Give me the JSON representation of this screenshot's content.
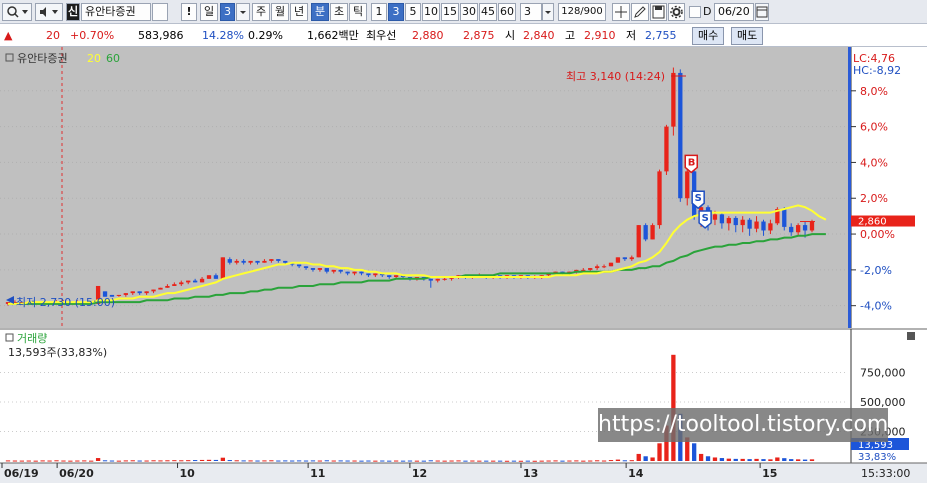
{
  "toolbar": {
    "stock_name": "유안타증권",
    "period_day": "일",
    "period_num": "3",
    "week": "주",
    "month": "월",
    "year": "년",
    "minute": "분",
    "second": "초",
    "tick": "틱",
    "intervals": [
      "1",
      "3",
      "5",
      "10",
      "15",
      "30",
      "45",
      "60"
    ],
    "interval_selected": "3",
    "interval_dropdown": "3",
    "count": "128/900",
    "d_label": "D",
    "date": "06/20",
    "exclaim": "!"
  },
  "quote": {
    "change": "20",
    "change_pct": "+0.70%",
    "volume": "583,986",
    "vol_pct": "14.28%",
    "turnover": "0.29%",
    "amount": "1,662백만",
    "best_bid_label": "최우선",
    "ask": "2,880",
    "bid": "2,875",
    "open_label": "시",
    "open": "2,840",
    "high_label": "고",
    "high": "2,910",
    "low_label": "저",
    "low": "2,755",
    "buy_label": "매수",
    "sell_label": "매도"
  },
  "colors": {
    "up": "#e8231a",
    "down": "#1c55d9",
    "ma20": "#ffff33",
    "ma60": "#2aa33a",
    "bg": "#c0c0c0"
  },
  "chart_data": {
    "type": "candlestick",
    "legend": {
      "name": "유안타증권",
      "ma_short": "20",
      "ma_long": "60"
    },
    "y_ticks": [
      "8,0%",
      "6,0%",
      "4,0%",
      "2,0%",
      "0,00%",
      "-2,0%",
      "-4,0%"
    ],
    "y_values": [
      8,
      6,
      4,
      2,
      0,
      -2,
      -4
    ],
    "ylim": [
      -4.8,
      10.0
    ],
    "lc_label": "LC:4,76",
    "hc_label": "HC:-8,92",
    "current_price": "2,860",
    "current_pct": 0.7,
    "high_annotation": "최고 3,140 (14:24)",
    "low_annotation": "최저 2,730 (15:00)",
    "signals": [
      "B",
      "S",
      "S"
    ],
    "x_labels": [
      "06/19",
      "06/20",
      "10",
      "11",
      "12",
      "13",
      "14",
      "15"
    ],
    "x_label_fracs": [
      0.0,
      0.065,
      0.207,
      0.361,
      0.481,
      0.612,
      0.736,
      0.894
    ],
    "candles": [
      [
        -3.9,
        -3.8,
        -4.0,
        -3.8,
        5000
      ],
      [
        -3.8,
        -3.8,
        -3.9,
        -3.7,
        4000
      ],
      [
        -3.8,
        -3.8,
        -3.9,
        -3.8,
        3500
      ],
      [
        -3.8,
        -3.8,
        -3.9,
        -3.8,
        4000
      ],
      [
        -3.8,
        -3.8,
        -3.9,
        -3.8,
        3000
      ],
      [
        -3.8,
        -3.8,
        -3.9,
        -3.8,
        5000
      ],
      [
        -3.8,
        -3.8,
        -3.8,
        -3.8,
        4000
      ],
      [
        -3.8,
        -3.8,
        -3.9,
        -3.7,
        6000
      ],
      [
        -3.8,
        -3.8,
        -3.8,
        -3.7,
        4000
      ],
      [
        -3.8,
        -3.8,
        -3.9,
        -3.8,
        3000
      ],
      [
        -3.8,
        -3.8,
        -3.8,
        -3.7,
        4000
      ],
      [
        -3.8,
        -3.8,
        -3.9,
        -3.8,
        5000
      ],
      [
        -3.8,
        -3.8,
        -3.8,
        -3.8,
        3000
      ],
      [
        -3.9,
        -2.9,
        -3.9,
        -2.9,
        25000
      ],
      [
        -3.2,
        -3.5,
        -3.5,
        -3.2,
        6000
      ],
      [
        -3.4,
        -3.5,
        -3.5,
        -3.4,
        4000
      ],
      [
        -3.4,
        -3.4,
        -3.5,
        -3.4,
        3000
      ],
      [
        -3.4,
        -3.3,
        -3.5,
        -3.3,
        5000
      ],
      [
        -3.3,
        -3.2,
        -3.4,
        -3.2,
        6000
      ],
      [
        -3.2,
        -3.3,
        -3.4,
        -3.2,
        4000
      ],
      [
        -3.3,
        -3.2,
        -3.4,
        -3.2,
        4000
      ],
      [
        -3.2,
        -3.1,
        -3.3,
        -3.1,
        6000
      ],
      [
        -3.1,
        -3.0,
        -3.1,
        -3.0,
        5000
      ],
      [
        -3.0,
        -2.9,
        -3.0,
        -2.8,
        6000
      ],
      [
        -2.9,
        -2.8,
        -2.9,
        -2.7,
        7000
      ],
      [
        -2.8,
        -2.7,
        -2.9,
        -2.6,
        6000
      ],
      [
        -2.7,
        -2.6,
        -2.8,
        -2.6,
        7000
      ],
      [
        -2.6,
        -2.7,
        -2.7,
        -2.5,
        8000
      ],
      [
        -2.7,
        -2.5,
        -2.7,
        -2.4,
        9000
      ],
      [
        -2.5,
        -2.3,
        -2.5,
        -2.3,
        10000
      ],
      [
        -2.3,
        -2.5,
        -2.5,
        -2.2,
        9000
      ],
      [
        -2.5,
        -1.3,
        -2.5,
        -1.3,
        28000
      ],
      [
        -1.4,
        -1.6,
        -1.7,
        -1.3,
        8000
      ],
      [
        -1.6,
        -1.5,
        -1.7,
        -1.4,
        6000
      ],
      [
        -1.5,
        -1.6,
        -1.7,
        -1.4,
        5000
      ],
      [
        -1.6,
        -1.5,
        -1.7,
        -1.5,
        5000
      ],
      [
        -1.5,
        -1.6,
        -1.7,
        -1.5,
        4000
      ],
      [
        -1.6,
        -1.5,
        -1.6,
        -1.4,
        5000
      ],
      [
        -1.5,
        -1.4,
        -1.6,
        -1.4,
        6000
      ],
      [
        -1.4,
        -1.5,
        -1.6,
        -1.4,
        4000
      ],
      [
        -1.5,
        -1.6,
        -1.7,
        -1.5,
        5000
      ],
      [
        -1.6,
        -1.7,
        -1.8,
        -1.6,
        4000
      ],
      [
        -1.7,
        -1.8,
        -1.9,
        -1.7,
        5000
      ],
      [
        -1.8,
        -1.9,
        -2.0,
        -1.8,
        4000
      ],
      [
        -1.9,
        -2.0,
        -2.1,
        -1.9,
        5000
      ],
      [
        -2.0,
        -1.9,
        -2.1,
        -1.9,
        4000
      ],
      [
        -1.9,
        -2.1,
        -2.2,
        -1.9,
        6000
      ],
      [
        -2.1,
        -2.0,
        -2.2,
        -2.0,
        4000
      ],
      [
        -2.0,
        -2.1,
        -2.2,
        -2.0,
        5000
      ],
      [
        -2.1,
        -2.2,
        -2.3,
        -2.1,
        4000
      ],
      [
        -2.2,
        -2.1,
        -2.3,
        -2.1,
        4000
      ],
      [
        -2.1,
        -2.2,
        -2.3,
        -2.1,
        3000
      ],
      [
        -2.2,
        -2.3,
        -2.4,
        -2.2,
        4000
      ],
      [
        -2.3,
        -2.2,
        -2.4,
        -2.2,
        3000
      ],
      [
        -2.2,
        -2.3,
        -2.4,
        -2.2,
        4000
      ],
      [
        -2.3,
        -2.4,
        -2.5,
        -2.3,
        3000
      ],
      [
        -2.4,
        -2.3,
        -2.5,
        -2.3,
        4000
      ],
      [
        -2.3,
        -2.4,
        -2.5,
        -2.3,
        3000
      ],
      [
        -2.4,
        -2.5,
        -2.6,
        -2.4,
        4000
      ],
      [
        -2.5,
        -2.4,
        -2.6,
        -2.4,
        3000
      ],
      [
        -2.4,
        -2.5,
        -2.6,
        -2.4,
        3000
      ],
      [
        -2.5,
        -2.6,
        -3.0,
        -2.5,
        6000
      ],
      [
        -2.6,
        -2.5,
        -2.7,
        -2.5,
        4000
      ],
      [
        -2.5,
        -2.5,
        -2.6,
        -2.4,
        3000
      ],
      [
        -2.5,
        -2.4,
        -2.6,
        -2.4,
        4000
      ],
      [
        -2.4,
        -2.3,
        -2.5,
        -2.3,
        5000
      ],
      [
        -2.3,
        -2.4,
        -2.5,
        -2.3,
        3000
      ],
      [
        -2.4,
        -2.3,
        -2.5,
        -2.3,
        4000
      ],
      [
        -2.3,
        -2.3,
        -2.4,
        -2.2,
        3000
      ],
      [
        -2.3,
        -2.4,
        -2.5,
        -2.3,
        3000
      ],
      [
        -2.4,
        -2.3,
        -2.5,
        -2.3,
        3000
      ],
      [
        -2.3,
        -2.4,
        -2.5,
        -2.3,
        3000
      ],
      [
        -2.4,
        -2.3,
        -2.5,
        -2.3,
        2000
      ],
      [
        -2.3,
        -2.4,
        -2.5,
        -2.3,
        3000
      ],
      [
        -2.4,
        -2.3,
        -2.5,
        -2.3,
        2000
      ],
      [
        -2.3,
        -2.4,
        -2.5,
        -2.3,
        3000
      ],
      [
        -2.4,
        -2.4,
        -2.5,
        -2.3,
        2000
      ],
      [
        -2.4,
        -2.3,
        -2.5,
        -2.3,
        3000
      ],
      [
        -2.3,
        -2.2,
        -2.4,
        -2.2,
        4000
      ],
      [
        -2.2,
        -2.1,
        -2.3,
        -2.1,
        5000
      ],
      [
        -2.1,
        -2.2,
        -2.3,
        -2.1,
        3000
      ],
      [
        -2.2,
        -2.1,
        -2.3,
        -2.1,
        4000
      ],
      [
        -2.1,
        -2.0,
        -2.2,
        -2.0,
        5000
      ],
      [
        -2.0,
        -2.0,
        -2.1,
        -1.9,
        3000
      ],
      [
        -2.0,
        -1.9,
        -2.1,
        -1.9,
        4000
      ],
      [
        -1.9,
        -1.8,
        -2.0,
        -1.7,
        6000
      ],
      [
        -1.8,
        -1.8,
        -1.9,
        -1.7,
        4000
      ],
      [
        -1.8,
        -1.6,
        -1.8,
        -1.6,
        8000
      ],
      [
        -1.6,
        -1.3,
        -1.6,
        -1.3,
        12000
      ],
      [
        -1.3,
        -1.4,
        -1.5,
        -1.3,
        6000
      ],
      [
        -1.4,
        -1.3,
        -1.5,
        -1.2,
        7000
      ],
      [
        -1.3,
        0.5,
        -1.3,
        0.5,
        60000
      ],
      [
        0.5,
        -0.3,
        -0.4,
        0.6,
        40000
      ],
      [
        -0.3,
        0.5,
        -0.3,
        0.6,
        30000
      ],
      [
        0.5,
        3.5,
        0.3,
        3.6,
        150000
      ],
      [
        3.5,
        6.0,
        3.3,
        6.1,
        300000
      ],
      [
        6.0,
        9.0,
        5.5,
        9.3,
        900000
      ],
      [
        9.0,
        2.0,
        1.8,
        9.2,
        400000
      ],
      [
        2.0,
        3.5,
        1.6,
        4.2,
        200000
      ],
      [
        3.5,
        1.0,
        0.8,
        3.6,
        150000
      ],
      [
        1.0,
        1.5,
        0.4,
        1.7,
        60000
      ],
      [
        1.5,
        0.8,
        0.2,
        1.6,
        40000
      ],
      [
        0.8,
        1.1,
        0.5,
        1.3,
        30000
      ],
      [
        1.1,
        0.6,
        0.3,
        1.2,
        25000
      ],
      [
        0.6,
        0.9,
        0.2,
        1.0,
        20000
      ],
      [
        0.9,
        0.5,
        0.1,
        1.0,
        18000
      ],
      [
        0.5,
        0.8,
        0.1,
        1.0,
        18000
      ],
      [
        0.8,
        0.3,
        -0.1,
        0.9,
        16000
      ],
      [
        0.3,
        0.7,
        0.1,
        1.0,
        18000
      ],
      [
        0.7,
        0.2,
        -0.1,
        0.8,
        16000
      ],
      [
        0.2,
        0.6,
        0.0,
        0.8,
        14000
      ],
      [
        0.6,
        1.4,
        0.5,
        1.5,
        30000
      ],
      [
        1.4,
        0.4,
        0.2,
        1.5,
        24000
      ],
      [
        0.4,
        0.1,
        -0.1,
        0.6,
        16000
      ],
      [
        0.1,
        0.5,
        -0.1,
        0.6,
        14000
      ],
      [
        0.5,
        0.2,
        -0.2,
        0.7,
        12000
      ],
      [
        0.2,
        0.7,
        0.1,
        0.8,
        14000
      ]
    ],
    "ma20": [
      -3.9,
      -3.9,
      -3.9,
      -3.8,
      -3.8,
      -3.8,
      -3.8,
      -3.8,
      -3.8,
      -3.8,
      -3.8,
      -3.8,
      -3.8,
      -3.7,
      -3.7,
      -3.7,
      -3.6,
      -3.6,
      -3.6,
      -3.5,
      -3.5,
      -3.5,
      -3.4,
      -3.3,
      -3.3,
      -3.2,
      -3.1,
      -3.0,
      -2.9,
      -2.8,
      -2.7,
      -2.5,
      -2.4,
      -2.3,
      -2.2,
      -2.1,
      -2.0,
      -1.9,
      -1.8,
      -1.7,
      -1.7,
      -1.6,
      -1.6,
      -1.6,
      -1.7,
      -1.7,
      -1.8,
      -1.8,
      -1.9,
      -1.9,
      -2.0,
      -2.0,
      -2.1,
      -2.1,
      -2.2,
      -2.2,
      -2.2,
      -2.3,
      -2.3,
      -2.3,
      -2.3,
      -2.4,
      -2.4,
      -2.4,
      -2.4,
      -2.4,
      -2.4,
      -2.4,
      -2.4,
      -2.4,
      -2.4,
      -2.4,
      -2.4,
      -2.4,
      -2.4,
      -2.4,
      -2.4,
      -2.4,
      -2.4,
      -2.3,
      -2.3,
      -2.3,
      -2.3,
      -2.2,
      -2.2,
      -2.2,
      -2.1,
      -2.1,
      -2.0,
      -1.9,
      -1.8,
      -1.6,
      -1.5,
      -1.3,
      -1.0,
      -0.5,
      0.1,
      0.5,
      0.8,
      1.0,
      1.1,
      1.2,
      1.2,
      1.2,
      1.2,
      1.2,
      1.2,
      1.2,
      1.2,
      1.2,
      1.2,
      1.3,
      1.4,
      1.5,
      1.6,
      1.5,
      1.3,
      1.0,
      0.8
    ],
    "ma60": [
      -3.9,
      -3.9,
      -3.9,
      -3.9,
      -3.9,
      -3.9,
      -3.9,
      -3.9,
      -3.9,
      -3.9,
      -3.9,
      -3.9,
      -3.9,
      -3.8,
      -3.8,
      -3.8,
      -3.8,
      -3.8,
      -3.8,
      -3.8,
      -3.7,
      -3.7,
      -3.7,
      -3.7,
      -3.6,
      -3.6,
      -3.6,
      -3.5,
      -3.5,
      -3.5,
      -3.4,
      -3.4,
      -3.3,
      -3.3,
      -3.3,
      -3.2,
      -3.2,
      -3.1,
      -3.1,
      -3.0,
      -3.0,
      -3.0,
      -2.9,
      -2.9,
      -2.9,
      -2.8,
      -2.8,
      -2.8,
      -2.7,
      -2.7,
      -2.7,
      -2.7,
      -2.6,
      -2.6,
      -2.6,
      -2.6,
      -2.5,
      -2.5,
      -2.5,
      -2.5,
      -2.5,
      -2.4,
      -2.4,
      -2.4,
      -2.4,
      -2.4,
      -2.3,
      -2.3,
      -2.3,
      -2.3,
      -2.3,
      -2.2,
      -2.2,
      -2.2,
      -2.2,
      -2.2,
      -2.2,
      -2.2,
      -2.2,
      -2.2,
      -2.2,
      -2.2,
      -2.1,
      -2.1,
      -2.1,
      -2.1,
      -2.1,
      -2.1,
      -2.0,
      -2.0,
      -2.0,
      -1.9,
      -1.9,
      -1.8,
      -1.8,
      -1.6,
      -1.5,
      -1.3,
      -1.2,
      -1.0,
      -0.9,
      -0.8,
      -0.7,
      -0.7,
      -0.6,
      -0.6,
      -0.5,
      -0.5,
      -0.4,
      -0.4,
      -0.3,
      -0.3,
      -0.2,
      -0.2,
      -0.1,
      -0.1,
      0.0,
      0.0,
      0.0
    ],
    "volume": {
      "title": "거래량",
      "value_label": "13,593주(33,83%)",
      "y_ticks": [
        "750,000",
        "500,000",
        "250,000"
      ],
      "y_values": [
        750000,
        500000,
        250000
      ],
      "ylim": [
        0,
        1000000
      ],
      "current_label": "13,593",
      "current_pct": "33,83%",
      "current_value": 13593
    },
    "time_label": "15:33:00"
  },
  "watermark": "https://tooltool.tistory.com"
}
